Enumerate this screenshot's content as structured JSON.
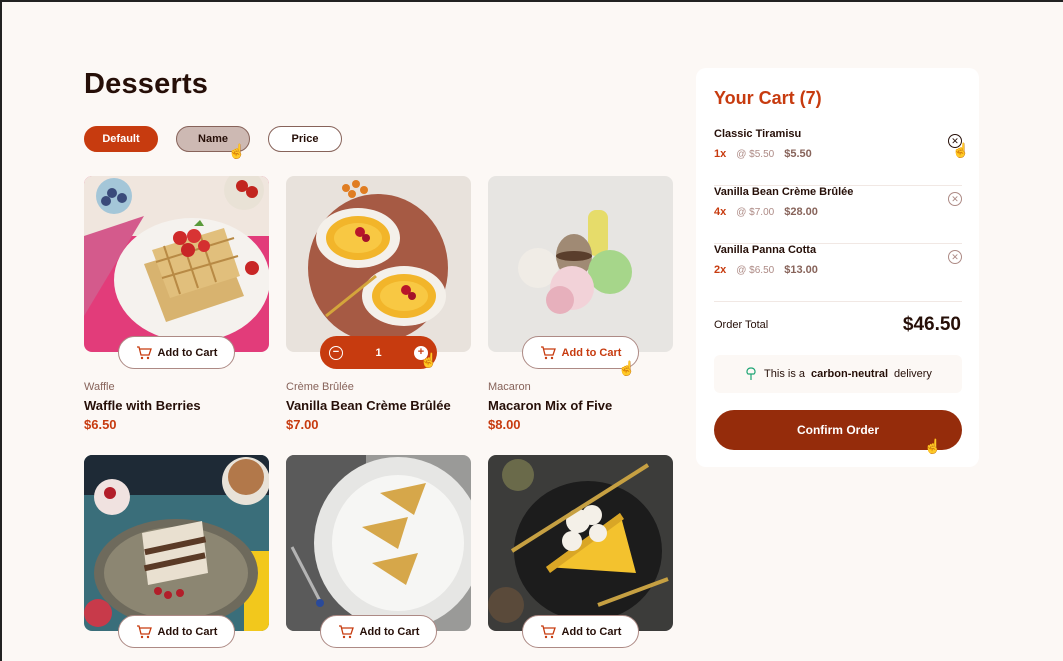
{
  "page": {
    "title": "Desserts"
  },
  "filters": [
    {
      "label": "Default",
      "state": "active"
    },
    {
      "label": "Name",
      "state": "hover"
    },
    {
      "label": "Price",
      "state": "plain"
    }
  ],
  "products": [
    {
      "category": "Waffle",
      "name": "Waffle with Berries",
      "price": "$6.50",
      "button": "Add to Cart"
    },
    {
      "category": "Crème Brûlée",
      "name": "Vanilla Bean Crème Brûlée",
      "price": "$7.00",
      "quantity": "1"
    },
    {
      "category": "Macaron",
      "name": "Macaron Mix of Five",
      "price": "$8.00",
      "button": "Add to Cart"
    },
    {
      "button": "Add to Cart"
    },
    {
      "button": "Add to Cart"
    },
    {
      "button": "Add to Cart"
    }
  ],
  "cart": {
    "title": "Your Cart (7)",
    "items": [
      {
        "name": "Classic Tiramisu",
        "qty": "1x",
        "unit": "@ $5.50",
        "total": "$5.50"
      },
      {
        "name": "Vanilla Bean Crème Brûlée",
        "qty": "4x",
        "unit": "@ $7.00",
        "total": "$28.00"
      },
      {
        "name": "Vanilla Panna Cotta",
        "qty": "2x",
        "unit": "@ $6.50",
        "total": "$13.00"
      }
    ],
    "order_total_label": "Order Total",
    "order_total_value": "$46.50",
    "carbon_prefix": "This is a",
    "carbon_bold": "carbon-neutral",
    "carbon_suffix": "delivery",
    "confirm_label": "Confirm Order"
  },
  "colors": {
    "accent": "#c73b0f",
    "dark_accent": "#952c0b",
    "background": "#fcf8f5"
  }
}
